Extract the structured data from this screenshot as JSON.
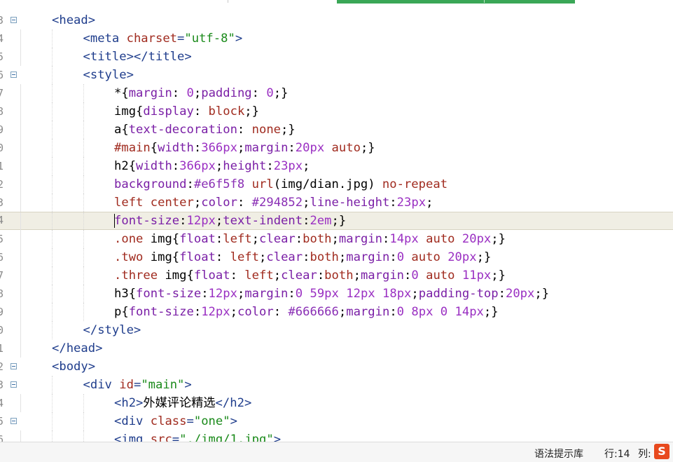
{
  "lines": [
    {
      "num": "3",
      "fold": true,
      "indent": 0,
      "tokens": [
        [
          "tag",
          "<head>"
        ]
      ]
    },
    {
      "num": "4",
      "fold": false,
      "indent": 1,
      "tokens": [
        [
          "tag",
          "<meta "
        ],
        [
          "attr",
          "charset"
        ],
        [
          "tag",
          "="
        ],
        [
          "str",
          "\"utf-8\""
        ],
        [
          "tag",
          ">"
        ]
      ]
    },
    {
      "num": "5",
      "fold": false,
      "indent": 1,
      "tokens": [
        [
          "tag",
          "<title></title>"
        ]
      ]
    },
    {
      "num": "6",
      "fold": true,
      "indent": 1,
      "tokens": [
        [
          "tag",
          "<style>"
        ]
      ]
    },
    {
      "num": "7",
      "fold": false,
      "indent": 2,
      "tokens": [
        [
          "txt",
          "*{"
        ],
        [
          "prop",
          "margin"
        ],
        [
          "txt",
          ": "
        ],
        [
          "num",
          "0"
        ],
        [
          "txt",
          ";"
        ],
        [
          "prop",
          "padding"
        ],
        [
          "txt",
          ": "
        ],
        [
          "num",
          "0"
        ],
        [
          "txt",
          ";}"
        ]
      ]
    },
    {
      "num": "8",
      "fold": false,
      "indent": 2,
      "tokens": [
        [
          "txt",
          "img{"
        ],
        [
          "prop",
          "display"
        ],
        [
          "txt",
          ": "
        ],
        [
          "val",
          "block"
        ],
        [
          "txt",
          ";}"
        ]
      ]
    },
    {
      "num": "9",
      "fold": false,
      "indent": 2,
      "tokens": [
        [
          "txt",
          "a{"
        ],
        [
          "prop",
          "text-decoration"
        ],
        [
          "txt",
          ": "
        ],
        [
          "val",
          "none"
        ],
        [
          "txt",
          ";}"
        ]
      ]
    },
    {
      "num": "0",
      "fold": false,
      "indent": 2,
      "tokens": [
        [
          "sel",
          "#main"
        ],
        [
          "txt",
          "{"
        ],
        [
          "prop",
          "width"
        ],
        [
          "txt",
          ":"
        ],
        [
          "num",
          "366px"
        ],
        [
          "txt",
          ";"
        ],
        [
          "prop",
          "margin"
        ],
        [
          "txt",
          ":"
        ],
        [
          "num",
          "20px"
        ],
        [
          "txt",
          " "
        ],
        [
          "val",
          "auto"
        ],
        [
          "txt",
          ";}"
        ]
      ]
    },
    {
      "num": "1",
      "fold": false,
      "indent": 2,
      "tokens": [
        [
          "txt",
          "h2{"
        ],
        [
          "prop",
          "width"
        ],
        [
          "txt",
          ":"
        ],
        [
          "num",
          "366px"
        ],
        [
          "txt",
          ";"
        ],
        [
          "prop",
          "height"
        ],
        [
          "txt",
          ":"
        ],
        [
          "num",
          "23px"
        ],
        [
          "txt",
          ";"
        ]
      ]
    },
    {
      "num": "2",
      "fold": false,
      "indent": 2,
      "tokens": [
        [
          "prop",
          "background"
        ],
        [
          "txt",
          ":"
        ],
        [
          "hex",
          "#e6f5f8"
        ],
        [
          "txt",
          " "
        ],
        [
          "val",
          "url"
        ],
        [
          "txt",
          "(img/dian.jpg) "
        ],
        [
          "val",
          "no-repeat"
        ]
      ]
    },
    {
      "num": "3",
      "fold": false,
      "indent": 2,
      "tokens": [
        [
          "val",
          "left"
        ],
        [
          "txt",
          " "
        ],
        [
          "val",
          "center"
        ],
        [
          "txt",
          ";"
        ],
        [
          "prop",
          "color"
        ],
        [
          "txt",
          ": "
        ],
        [
          "hex",
          "#294852"
        ],
        [
          "txt",
          ";"
        ],
        [
          "prop",
          "line-height"
        ],
        [
          "txt",
          ":"
        ],
        [
          "num",
          "23px"
        ],
        [
          "txt",
          ";"
        ]
      ]
    },
    {
      "num": "4",
      "fold": false,
      "indent": 2,
      "current": true,
      "tokens": [
        [
          "caret",
          ""
        ],
        [
          "prop",
          "font-size"
        ],
        [
          "txt",
          ":"
        ],
        [
          "num",
          "12px"
        ],
        [
          "txt",
          ";"
        ],
        [
          "prop",
          "text-indent"
        ],
        [
          "txt",
          ":"
        ],
        [
          "num",
          "2em"
        ],
        [
          "txt",
          ";}"
        ]
      ]
    },
    {
      "num": "5",
      "fold": false,
      "indent": 2,
      "tokens": [
        [
          "sel",
          ".one"
        ],
        [
          "txt",
          " img{"
        ],
        [
          "prop",
          "float"
        ],
        [
          "txt",
          ":"
        ],
        [
          "val",
          "left"
        ],
        [
          "txt",
          ";"
        ],
        [
          "prop",
          "clear"
        ],
        [
          "txt",
          ":"
        ],
        [
          "val",
          "both"
        ],
        [
          "txt",
          ";"
        ],
        [
          "prop",
          "margin"
        ],
        [
          "txt",
          ":"
        ],
        [
          "num",
          "14px"
        ],
        [
          "txt",
          " "
        ],
        [
          "val",
          "auto"
        ],
        [
          "txt",
          " "
        ],
        [
          "num",
          "20px"
        ],
        [
          "txt",
          ";}"
        ]
      ]
    },
    {
      "num": "6",
      "fold": false,
      "indent": 2,
      "tokens": [
        [
          "sel",
          ".two"
        ],
        [
          "txt",
          " img{"
        ],
        [
          "prop",
          "float"
        ],
        [
          "txt",
          ": "
        ],
        [
          "val",
          "left"
        ],
        [
          "txt",
          ";"
        ],
        [
          "prop",
          "clear"
        ],
        [
          "txt",
          ":"
        ],
        [
          "val",
          "both"
        ],
        [
          "txt",
          ";"
        ],
        [
          "prop",
          "margin"
        ],
        [
          "txt",
          ":"
        ],
        [
          "num",
          "0"
        ],
        [
          "txt",
          " "
        ],
        [
          "val",
          "auto"
        ],
        [
          "txt",
          " "
        ],
        [
          "num",
          "20px"
        ],
        [
          "txt",
          ";}"
        ]
      ]
    },
    {
      "num": "7",
      "fold": false,
      "indent": 2,
      "tokens": [
        [
          "sel",
          ".three"
        ],
        [
          "txt",
          " img{"
        ],
        [
          "prop",
          "float"
        ],
        [
          "txt",
          ": "
        ],
        [
          "val",
          "left"
        ],
        [
          "txt",
          ";"
        ],
        [
          "prop",
          "clear"
        ],
        [
          "txt",
          ":"
        ],
        [
          "val",
          "both"
        ],
        [
          "txt",
          ";"
        ],
        [
          "prop",
          "margin"
        ],
        [
          "txt",
          ":"
        ],
        [
          "num",
          "0"
        ],
        [
          "txt",
          " "
        ],
        [
          "val",
          "auto"
        ],
        [
          "txt",
          " "
        ],
        [
          "num",
          "11px"
        ],
        [
          "txt",
          ";}"
        ]
      ]
    },
    {
      "num": "8",
      "fold": false,
      "indent": 2,
      "tokens": [
        [
          "txt",
          "h3{"
        ],
        [
          "prop",
          "font-size"
        ],
        [
          "txt",
          ":"
        ],
        [
          "num",
          "12px"
        ],
        [
          "txt",
          ";"
        ],
        [
          "prop",
          "margin"
        ],
        [
          "txt",
          ":"
        ],
        [
          "num",
          "0"
        ],
        [
          "txt",
          " "
        ],
        [
          "num",
          "59px"
        ],
        [
          "txt",
          " "
        ],
        [
          "num",
          "12px"
        ],
        [
          "txt",
          " "
        ],
        [
          "num",
          "18px"
        ],
        [
          "txt",
          ";"
        ],
        [
          "prop",
          "padding-top"
        ],
        [
          "txt",
          ":"
        ],
        [
          "num",
          "20px"
        ],
        [
          "txt",
          ";}"
        ]
      ]
    },
    {
      "num": "9",
      "fold": false,
      "indent": 2,
      "tokens": [
        [
          "txt",
          "p{"
        ],
        [
          "prop",
          "font-size"
        ],
        [
          "txt",
          ":"
        ],
        [
          "num",
          "12px"
        ],
        [
          "txt",
          ";"
        ],
        [
          "prop",
          "color"
        ],
        [
          "txt",
          ": "
        ],
        [
          "hex",
          "#666666"
        ],
        [
          "txt",
          ";"
        ],
        [
          "prop",
          "margin"
        ],
        [
          "txt",
          ":"
        ],
        [
          "num",
          "0"
        ],
        [
          "txt",
          " "
        ],
        [
          "num",
          "8px"
        ],
        [
          "txt",
          " "
        ],
        [
          "num",
          "0"
        ],
        [
          "txt",
          " "
        ],
        [
          "num",
          "14px"
        ],
        [
          "txt",
          ";}"
        ]
      ]
    },
    {
      "num": "0",
      "fold": false,
      "indent": 1,
      "tokens": [
        [
          "tag",
          "</style>"
        ]
      ]
    },
    {
      "num": "1",
      "fold": false,
      "indent": 0,
      "tokens": [
        [
          "tag",
          "</head>"
        ]
      ]
    },
    {
      "num": "2",
      "fold": true,
      "indent": 0,
      "tokens": [
        [
          "tag",
          "<body>"
        ]
      ]
    },
    {
      "num": "3",
      "fold": true,
      "indent": 1,
      "tokens": [
        [
          "tag",
          "<div "
        ],
        [
          "attr",
          "id"
        ],
        [
          "tag",
          "="
        ],
        [
          "str",
          "\"main\""
        ],
        [
          "tag",
          ">"
        ]
      ]
    },
    {
      "num": "4",
      "fold": false,
      "indent": 2,
      "tokens": [
        [
          "tag",
          "<h2>"
        ],
        [
          "txt",
          "外媒评论精选"
        ],
        [
          "tag",
          "</h2>"
        ]
      ]
    },
    {
      "num": "5",
      "fold": true,
      "indent": 2,
      "tokens": [
        [
          "tag",
          "<div "
        ],
        [
          "attr",
          "class"
        ],
        [
          "tag",
          "="
        ],
        [
          "str",
          "\"one\""
        ],
        [
          "tag",
          ">"
        ]
      ]
    },
    {
      "num": "6",
      "fold": false,
      "indent": 2,
      "tokens": [
        [
          "tag",
          "<img "
        ],
        [
          "attr",
          "src"
        ],
        [
          "tag",
          "="
        ],
        [
          "str",
          "\"./img/1.jpg\""
        ],
        [
          "tag",
          ">"
        ]
      ]
    }
  ],
  "statusbar": {
    "library": "语法提示库",
    "row_label": "行:14",
    "col_label": "列:"
  },
  "ime_icon": "sogou-input-icon",
  "ime_glyph": "S",
  "colors": {
    "tag": "#1f3d8c",
    "attr": "#a02b1f",
    "string": "#1a8a1a",
    "property": "#7a1fa6",
    "current_line": "#f0eee4",
    "accent_bar": "#3aa757"
  }
}
